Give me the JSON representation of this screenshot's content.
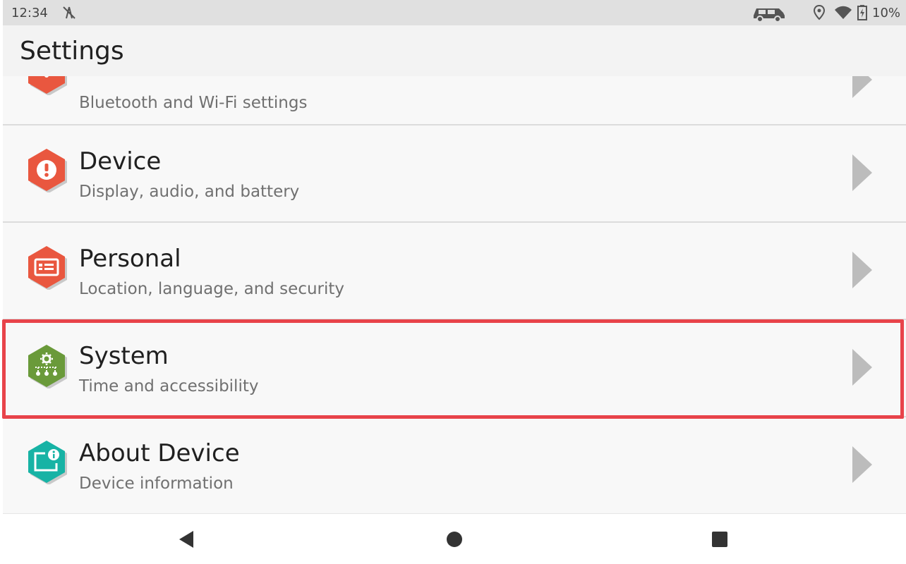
{
  "status_bar": {
    "time": "12:34",
    "battery_percent": "10%",
    "icons": [
      "no-signal-antenna-icon",
      "car-icon",
      "location-icon",
      "wifi-icon",
      "battery-charging-icon"
    ]
  },
  "app_bar": {
    "title": "Settings"
  },
  "settings_list": {
    "items": [
      {
        "title": "",
        "subtitle": "Bluetooth and Wi-Fi settings",
        "icon": "connections-icon",
        "color": "#e9573f"
      },
      {
        "title": "Device",
        "subtitle": "Display, audio, and battery",
        "icon": "alert-icon",
        "color": "#e9573f"
      },
      {
        "title": "Personal",
        "subtitle": "Location, language, and security",
        "icon": "id-card-icon",
        "color": "#e9573f"
      },
      {
        "title": "System",
        "subtitle": "Time and accessibility",
        "icon": "system-gear-icon",
        "color": "#6a9a3a"
      },
      {
        "title": "About Device",
        "subtitle": "Device information",
        "icon": "device-info-icon",
        "color": "#17b3a5"
      }
    ],
    "highlighted_item": "System",
    "highlight_color": "#e8434a"
  },
  "nav_bar": {
    "buttons": [
      "back-icon",
      "home-icon",
      "recents-icon"
    ]
  }
}
